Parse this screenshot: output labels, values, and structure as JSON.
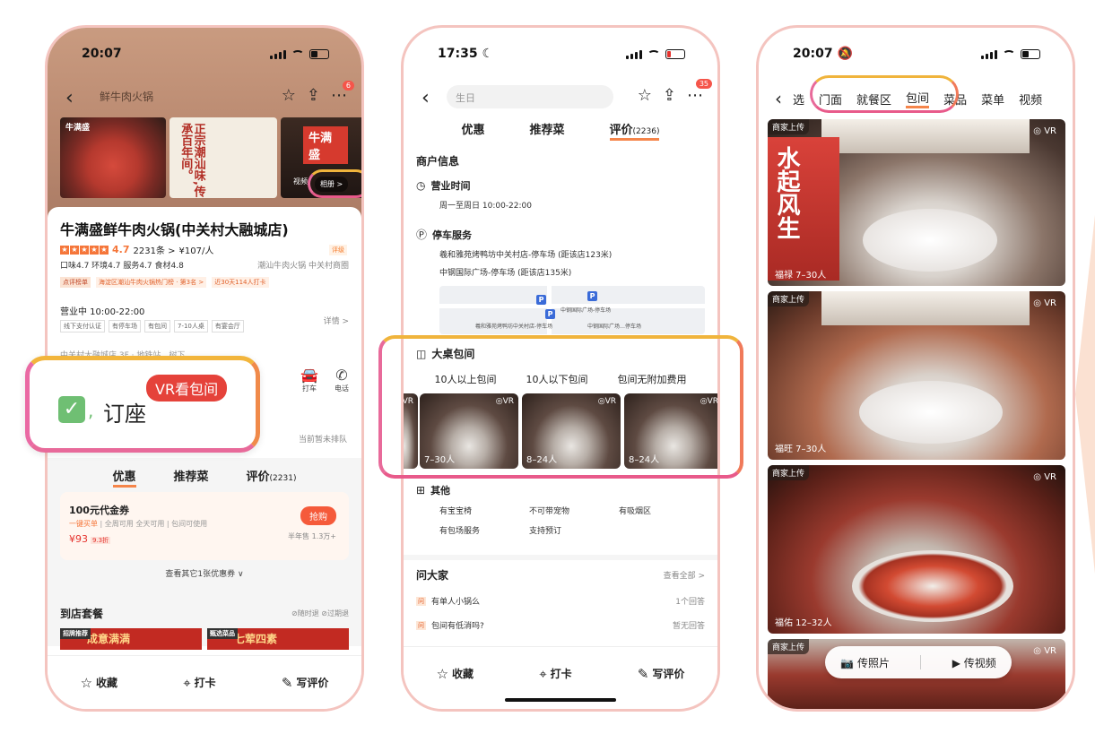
{
  "phone1": {
    "status": {
      "time": "20:07"
    },
    "nav": {
      "title": "鲜牛肉火锅",
      "badge": "6"
    },
    "gallery": {
      "poster_text": "正宗潮汕味,传承百年间。",
      "shop_sign": "牛满盛",
      "brand": "牛满盛",
      "video_label": "视频",
      "album_label": "相册 >"
    },
    "shop": {
      "name": "牛满盛鲜牛肉火锅(中关村大融城店)",
      "rating": "4.7",
      "reviews": "2231条 >",
      "price": "¥107/人",
      "badge": "评级",
      "scores": "口味4.7  环境4.7  服务4.7  食材4.8",
      "category": "潮汕牛肉火锅  中关村商圈",
      "rank_tag": "点评榜单",
      "rank_text": "海淀区潮汕牛肉火锅热门榜 · 第3名 >",
      "checkin": "近30天114人打卡",
      "hours": "营业中 10:00-22:00",
      "detail": "详情 >",
      "facilities": [
        "线下支付认证",
        "有停车场",
        "有包间",
        "7-10人桌",
        "有宴会厅"
      ],
      "address": "中关村大融城店 3F · 地铁站…树下",
      "action_taxi": "打车",
      "action_call": "电话",
      "queue": "当前暂未排队"
    },
    "overlay": {
      "seat": "订座",
      "vr": "VR看包间"
    },
    "tabs": {
      "deals": "优惠",
      "dishes": "推荐菜",
      "reviews": "评价",
      "reviews_count": "(2231)"
    },
    "voucher": {
      "title": "100元代金券",
      "sub_hl": "一键买单",
      "sub_rest": " | 全周可用 全天可用 | 包间可使用",
      "price": "¥93",
      "discount": "9.3折",
      "grab": "抢购",
      "sold": "半年售 1.3万+"
    },
    "more_deals": "查看其它1张优惠券 ∨",
    "package": {
      "title": "到店套餐",
      "opts": "⊘随时退  ⊘过期退",
      "img1_label": "招牌推荐",
      "img1_text": "成意满满",
      "img2_label": "甄选菜品",
      "img2_text": "七荤四素"
    },
    "bottom": {
      "fav": "收藏",
      "checkin": "打卡",
      "review": "写评价"
    }
  },
  "phone2": {
    "status": {
      "time": "17:35"
    },
    "search": {
      "placeholder": "生日"
    },
    "badge": "35",
    "tabs": {
      "deals": "优惠",
      "dishes": "推荐菜",
      "reviews": "评价",
      "reviews_count": "(2236)"
    },
    "merchant_info": "商户信息",
    "hours_title": "营业时间",
    "hours_value": "周一至周日  10:00-22:00",
    "parking_title": "停车服务",
    "parking_1": "羲和雅苑烤鸭坊中关村店-停车场 (距该店123米)",
    "parking_2": "中钢国际广场-停车场 (距该店135米)",
    "map_labels": [
      "中钢国际广场-停车场",
      "羲和雅苑烤鸭坊中关村店-停车场",
      "中钢国际广场…停车场"
    ],
    "rooms": {
      "title": "大桌包间",
      "tab1": "10人以上包间",
      "tab2": "10人以下包间",
      "tab3": "包间无附加费用",
      "caps": [
        "7–30人",
        "8–24人",
        "8–24人"
      ],
      "vr": "VR"
    },
    "other": {
      "title": "其他",
      "items": [
        "有宝宝椅",
        "不可带宠物",
        "有吸烟区",
        "有包场服务",
        "支持预订"
      ]
    },
    "qa": {
      "title": "问大家",
      "all": "查看全部 >",
      "q1": "有单人小锅么",
      "a1": "1个回答",
      "q2": "包间有低消吗?",
      "a2": "暂无回答",
      "tag": "问"
    },
    "bottom": {
      "fav": "收藏",
      "checkin": "打卡",
      "review": "写评价"
    }
  },
  "phone3": {
    "status": {
      "time": "20:07"
    },
    "tabs": [
      "选",
      "门面",
      "就餐区",
      "包间",
      "菜品",
      "菜单",
      "视频"
    ],
    "uploaded": "商家上传",
    "vr": "VR",
    "rooms": [
      {
        "caption": "福禄 7–30人",
        "calligraphy": "水起风生"
      },
      {
        "caption": "福旺 7–30人"
      },
      {
        "caption": "福佑 12–32人"
      },
      {
        "caption": ""
      }
    ],
    "upload_photo": "传照片",
    "upload_video": "传视频"
  }
}
